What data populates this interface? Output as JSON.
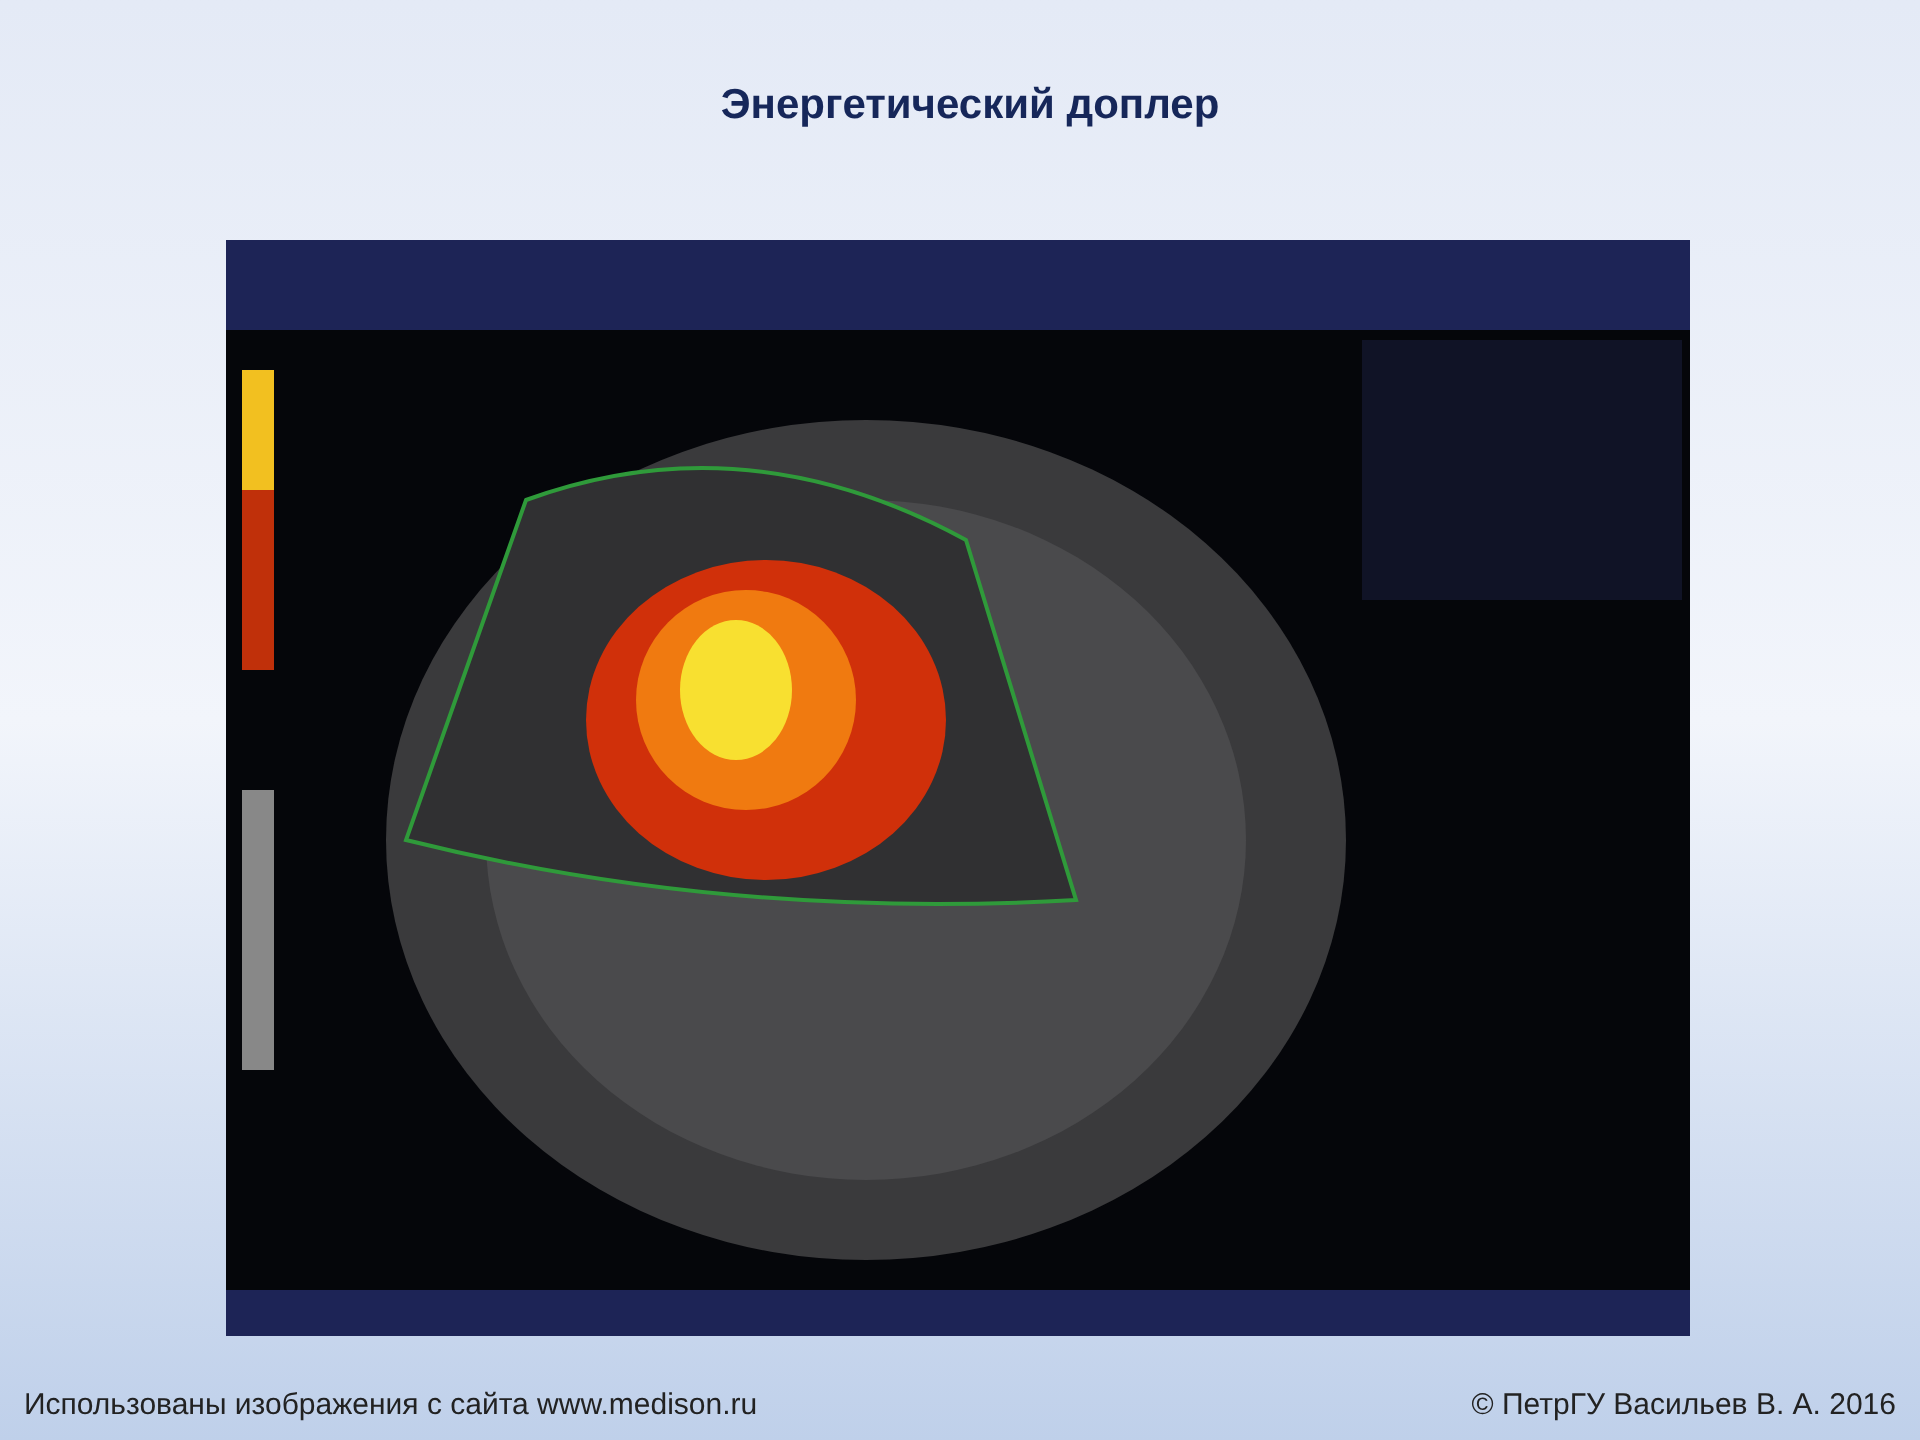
{
  "slide": {
    "title": "Энергетический доплер"
  },
  "footer": {
    "source": "Использованы изображения с сайта www.medison.ru",
    "copyright": "© ПетрГУ Васильев В. А. 2016"
  }
}
